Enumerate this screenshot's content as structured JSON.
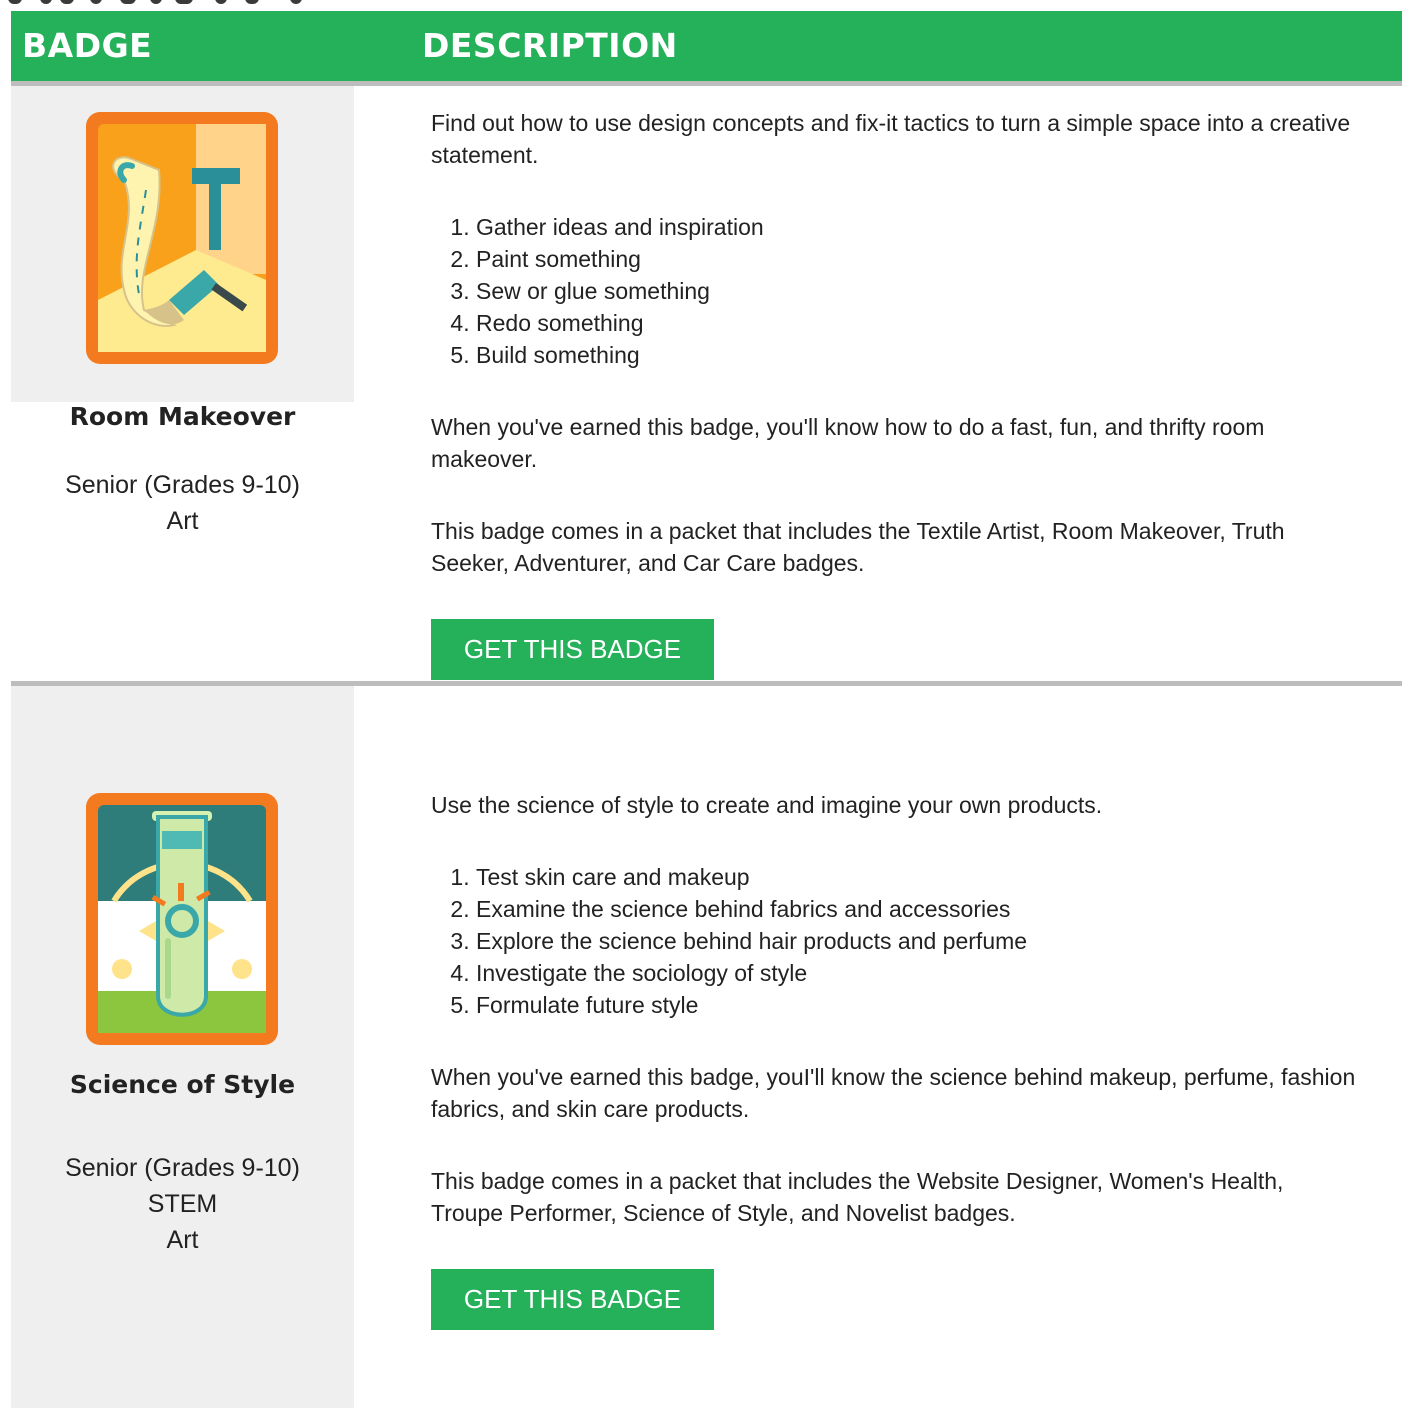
{
  "colors": {
    "accent_green": "#25b05a",
    "badge_cell_bg": "#efefef",
    "row_divider": "#bdbdbd"
  },
  "header": {
    "col_badge": "BADGE",
    "col_description": "DESCRIPTION"
  },
  "badges": [
    {
      "icon": "room-makeover-badge-icon",
      "name": "Room Makeover",
      "meta": [
        "Senior (Grades 9-10)",
        "Art"
      ],
      "intro": "Find out how to use design concepts and fix-it tactics to turn a simple space into a creative statement.",
      "steps": [
        "Gather ideas and inspiration",
        "Paint something",
        "Sew or glue something",
        "Redo something",
        "Build something"
      ],
      "earned": "When you've earned this badge, you'll know how to do a fast, fun, and thrifty room makeover.",
      "packet": "This badge comes in a packet that includes the Textile Artist, Room Makeover, Truth Seeker, Adventurer, and Car Care badges.",
      "button": "GET THIS BADGE"
    },
    {
      "icon": "science-of-style-badge-icon",
      "name": "Science of Style",
      "meta": [
        "Senior (Grades 9-10)",
        "STEM",
        "Art"
      ],
      "intro": "Use the science of style to create and imagine your own products.",
      "steps": [
        "Test skin care and makeup",
        "Examine the science behind fabrics and accessories",
        "Explore the science behind hair products and perfume",
        "Investigate the sociology of style",
        "Formulate future style"
      ],
      "earned": "When you've earned this badge, youI'll know the science behind makeup, perfume, fashion fabrics, and skin care products.",
      "packet": "This badge comes in a packet that includes the Website Designer, Women's Health, Troupe Performer, Science of Style, and Novelist badges.",
      "button": "GET THIS BADGE"
    }
  ]
}
